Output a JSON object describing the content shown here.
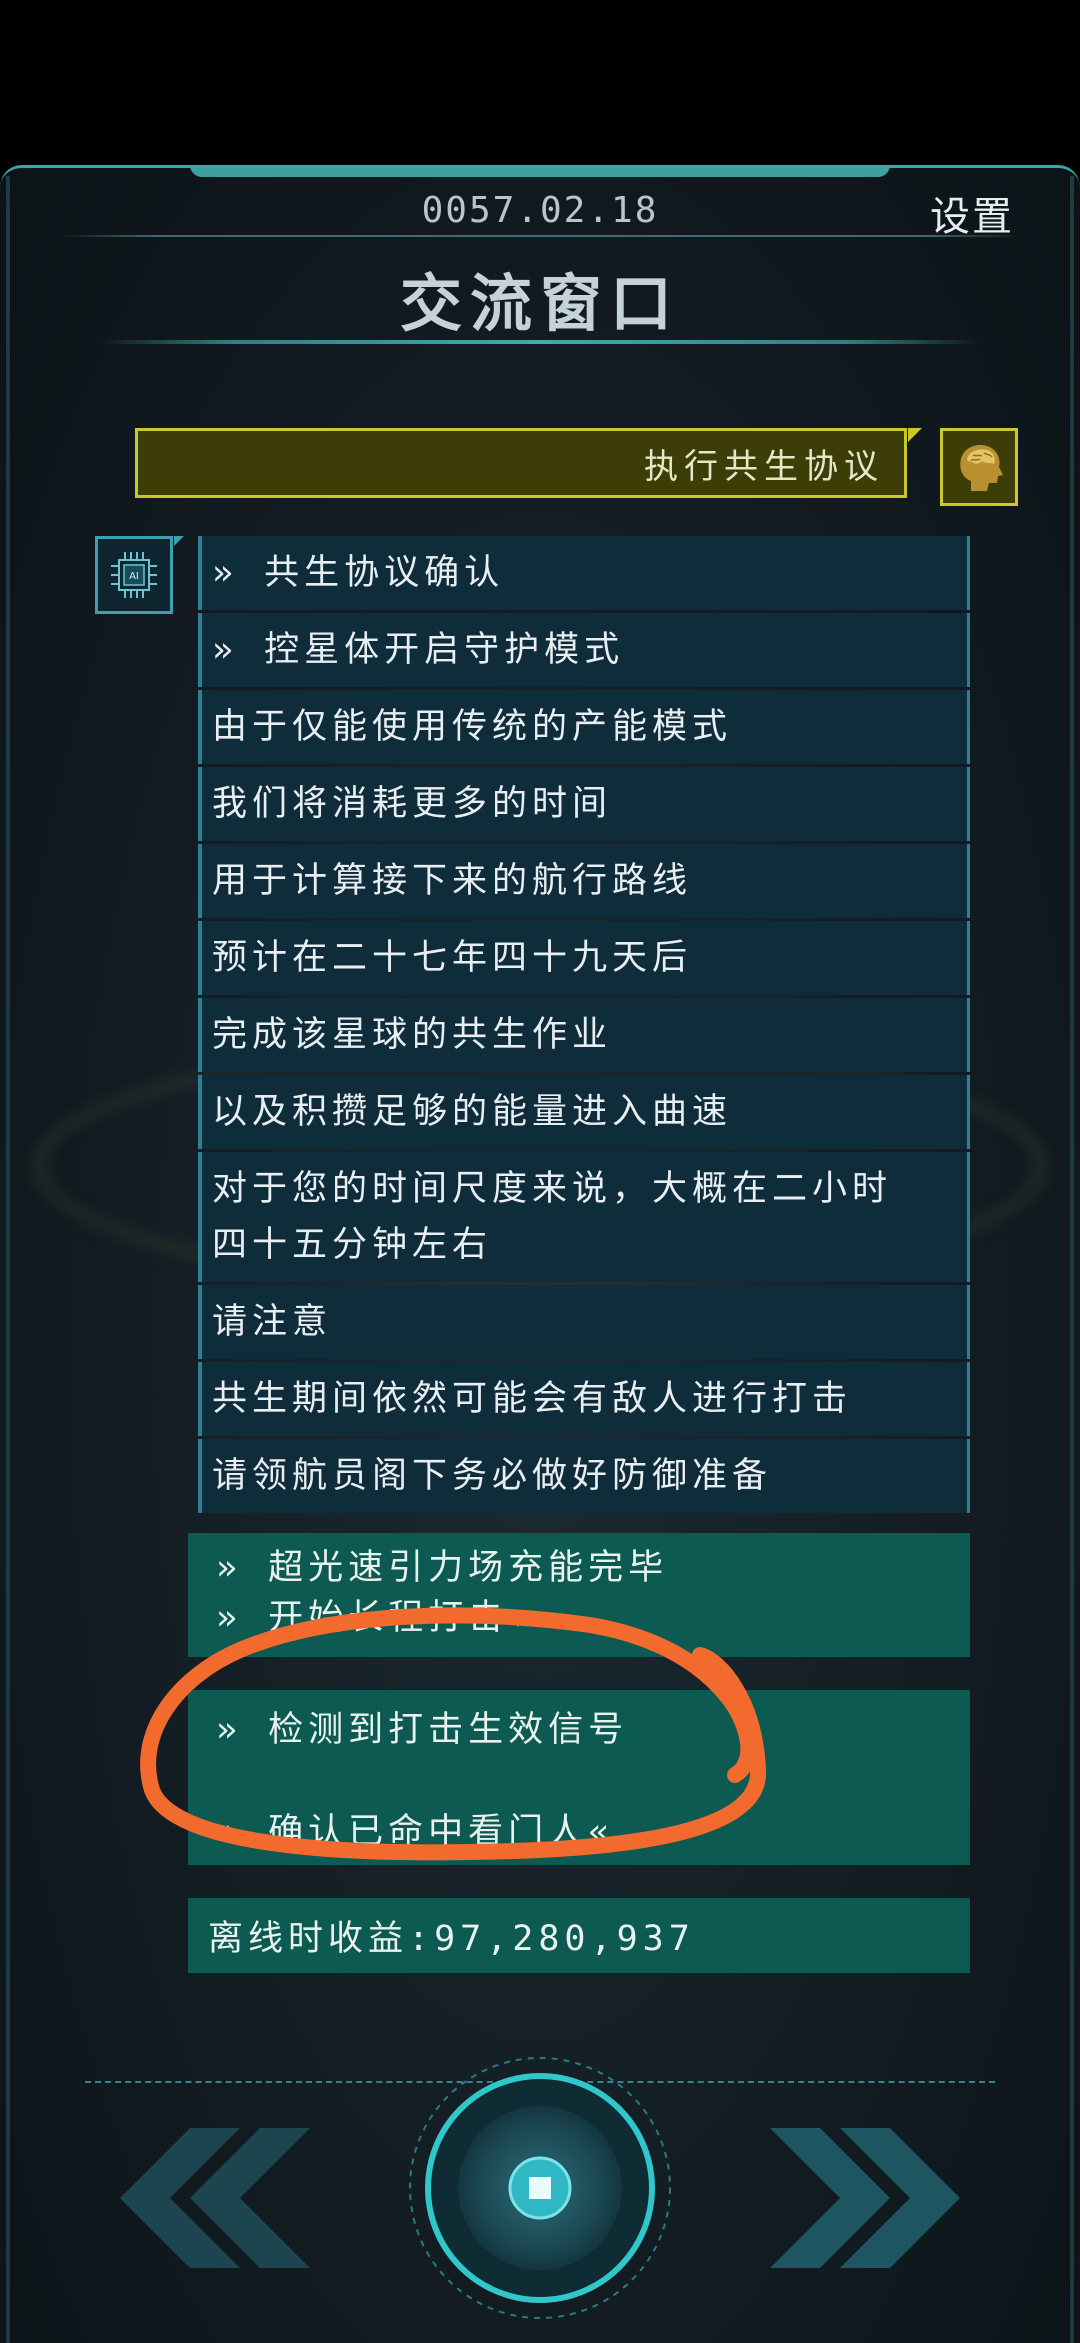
{
  "header": {
    "date": "0057.02.18",
    "settings_label": "设置",
    "title": "交流窗口"
  },
  "player_message": "执行共生协议",
  "ai_messages": [
    "» 共生协议确认",
    "» 控星体开启守护模式",
    "由于仅能使用传统的产能模式",
    "我们将消耗更多的时间",
    "用于计算接下来的航行路线",
    "预计在二十七年四十九天后",
    "完成该星球的共生作业",
    "以及积攒足够的能量进入曲速",
    "对于您的时间尺度来说，大概在二小时",
    "四十五分钟左右",
    "请注意",
    "共生期间依然可能会有敌人进行打击",
    "请领航员阁下务必做好防御准备"
  ],
  "system_messages": [
    "» 超光速引力场充能完毕",
    "» 开始长程打击«",
    "» 检测到打击生效信号",
    "» 确认已命中看门人«"
  ],
  "offline_income": "离线时收益:97,280,937",
  "ai_avatar_label": "AI",
  "colors": {
    "player_bubble": "#3c3d07",
    "player_border": "#c9c92a",
    "ai_bubble": "#0f2c3b",
    "system_bubble": "#0d5a52",
    "accent": "#3aa6a6",
    "annotation": "#f26a2e"
  }
}
